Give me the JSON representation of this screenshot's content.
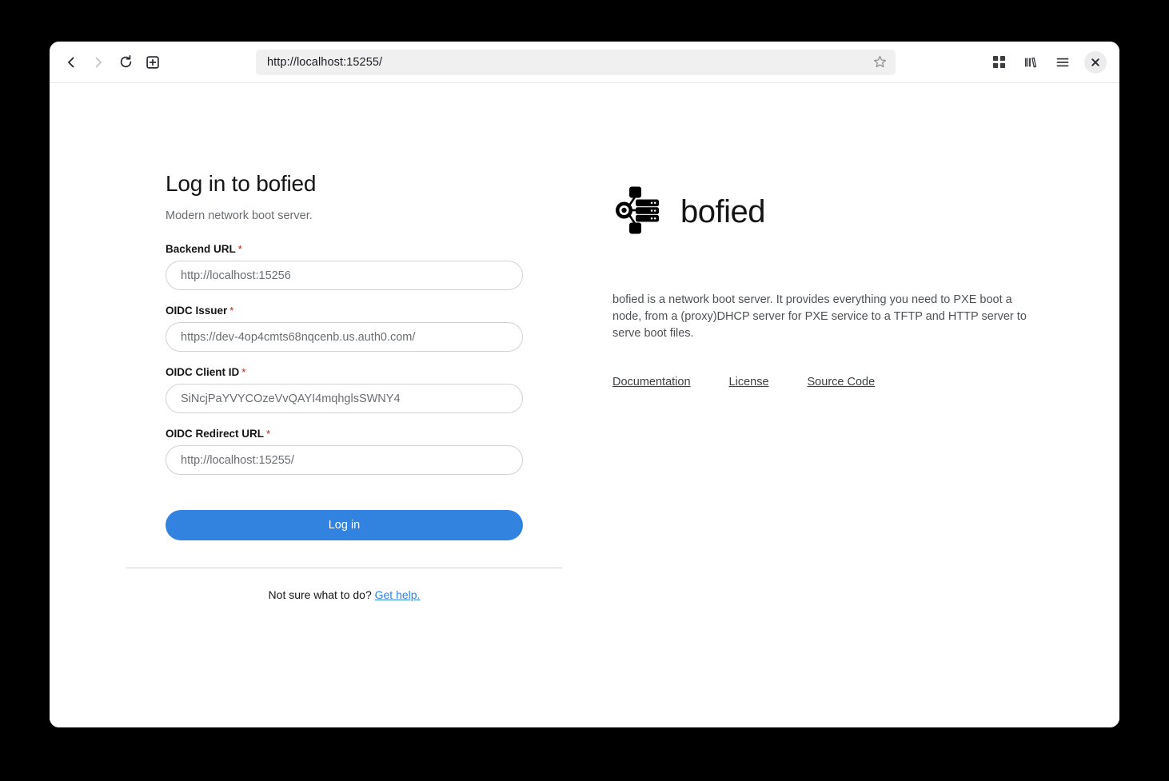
{
  "browser": {
    "url": "http://localhost:15255/",
    "back_label": "Back",
    "forward_label": "Forward",
    "reload_label": "Reload",
    "new_tab_label": "New Tab",
    "bookmark_label": "Bookmark this page",
    "extensions_label": "Extensions",
    "library_label": "Library",
    "menu_label": "Open application menu",
    "close_label": "Close"
  },
  "login": {
    "title": "Log in to bofied",
    "subtitle": "Modern network boot server.",
    "required_marker": "*",
    "fields": [
      {
        "label": "Backend URL",
        "value": "http://localhost:15256",
        "placeholder": "http://localhost:15256"
      },
      {
        "label": "OIDC Issuer",
        "value": "https://dev-4op4cmts68nqcenb.us.auth0.com/",
        "placeholder": "https://dev-4op4cmts68nqcenb.us.auth0.com/"
      },
      {
        "label": "OIDC Client ID",
        "value": "SiNcjPaYVYCOzeVvQAYI4mqhglsSWNY4",
        "placeholder": "SiNcjPaYVYCOzeVvQAYI4mqhglsSWNY4"
      },
      {
        "label": "OIDC Redirect URL",
        "value": "http://localhost:15255/",
        "placeholder": "http://localhost:15255/"
      }
    ],
    "submit_label": "Log in",
    "help_prompt": "Not sure what to do?",
    "help_link": "Get help."
  },
  "about": {
    "logo_icon": "network-boot-server-icon",
    "brand": "bofied",
    "description": "bofied is a network boot server. It provides everything you need to PXE boot a node, from a (proxy)DHCP server for PXE service to a TFTP and HTTP server to serve boot files.",
    "links": [
      "Documentation",
      "License",
      "Source Code"
    ]
  },
  "colors": {
    "accent": "#3282e0",
    "required": "#c9190b",
    "text": "#151515",
    "muted": "#6a6e73"
  }
}
